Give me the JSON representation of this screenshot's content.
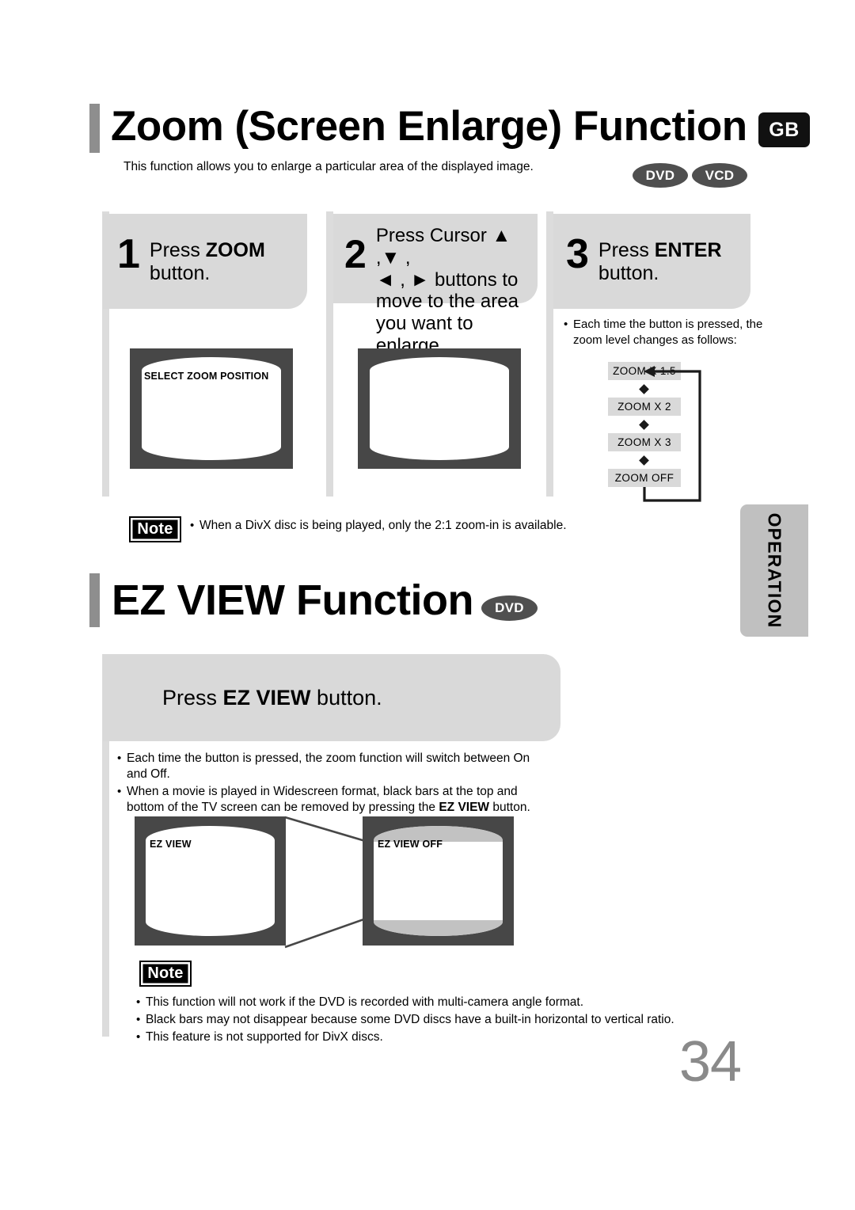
{
  "page": {
    "number": "34",
    "side_tab": "OPERATION",
    "language_badge": "GB"
  },
  "zoom_section": {
    "title": "Zoom (Screen Enlarge) Function",
    "intro": "This function allows you to enlarge a particular area of the displayed image.",
    "disc_badges": [
      "DVD",
      "VCD"
    ],
    "steps": [
      {
        "number": "1",
        "text_html": "Press <b>ZOOM</b><br>button."
      },
      {
        "number": "2",
        "text_html": "Press Cursor ▲ ,▼ ,<br>◄ , ► buttons to<br>move to the area<br>you want to enlarge."
      },
      {
        "number": "3",
        "text_html": "Press <b>ENTER</b><br>button."
      }
    ],
    "tv_osd_step1": "SELECT ZOOM POSITION",
    "tv_osd_step2": "",
    "zoom_note_intro": "Each time the button is pressed, the zoom level changes as follows:",
    "zoom_levels": [
      "ZOOM X 1.5",
      "ZOOM X 2",
      "ZOOM X 3",
      "ZOOM  OFF"
    ],
    "note_label": "Note",
    "note_text": "When a DivX disc is being played, only the 2:1 zoom-in is available."
  },
  "ezview_section": {
    "title": "EZ VIEW Function",
    "disc_badge": "DVD",
    "instruction_html": "Press <b>EZ VIEW</b> button.",
    "bullets_html": [
      "Each time the button is pressed, the zoom function will switch between On and Off.",
      "When a movie is played in Widescreen format, black bars at the top and bottom of the TV screen can be removed by pressing the <b>EZ VIEW</b> button."
    ],
    "tv_osd_left": "EZ VIEW",
    "tv_osd_right": "EZ VIEW OFF",
    "note_label": "Note",
    "notes_html": [
      "This function will not work if the DVD is recorded with multi-camera angle format.",
      "Black bars may not disappear because some DVD discs have a built-in horizontal to vertical ratio.",
      "This feature is not supported for DivX discs."
    ]
  },
  "colors": {
    "panel_gray": "#d9d9d9",
    "rule_gray": "#dcdcdc",
    "tv_bezel": "#474747",
    "badge_dark": "#4f4f4f",
    "page_num_gray": "#8a8a8a"
  }
}
